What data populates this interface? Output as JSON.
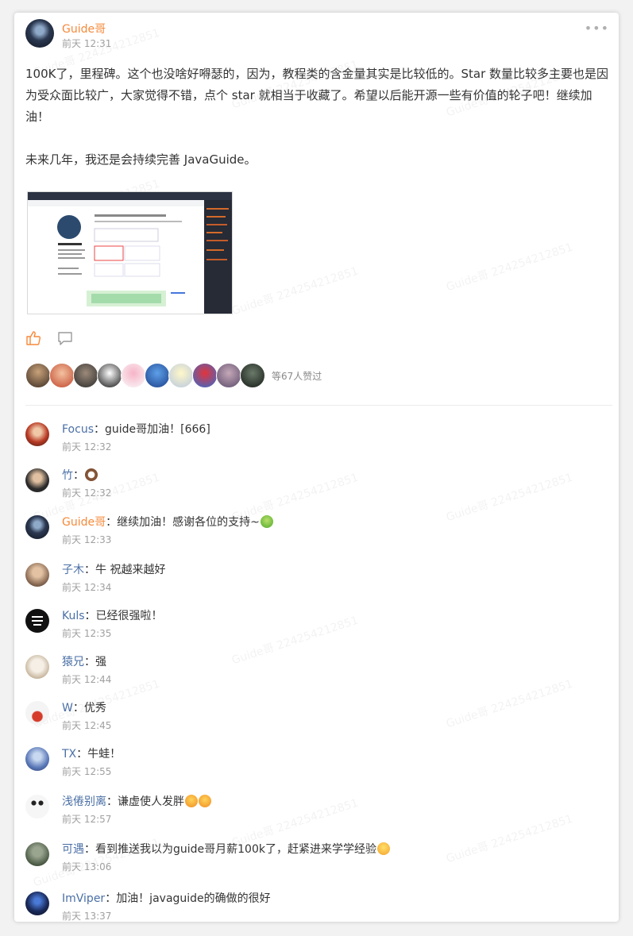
{
  "post": {
    "author": "Guide哥",
    "time": "前天 12:31",
    "paragraph1": "100K了，里程碑。这个也没啥好嘚瑟的，因为，教程类的含金量其实是比较低的。Star 数量比较多主要也是因为受众面比较广，大家觉得不错，点个 star 就相当于收藏了。希望以后能开源一些有价值的轮子吧！继续加油！",
    "paragraph2": "未来几年，我还是会持续完善 JavaGuide。",
    "more_icon": "more-dots-icon",
    "like_icon": "thumbs-up-icon",
    "comment_icon": "comment-bubble-icon",
    "likes_text": "等67人赞过"
  },
  "comments": [
    {
      "name": "Focus",
      "sep": "：",
      "text": "guide哥加油！[666]",
      "time": "前天 12:32"
    },
    {
      "name": "竹",
      "sep": "：",
      "text": "",
      "emoji": "cow-emoji",
      "time": "前天 12:32"
    },
    {
      "name": "Guide哥",
      "sep": "：",
      "text": "继续加油！感谢各位的支持~",
      "emoji": "green-emoji",
      "time": "前天 12:33"
    },
    {
      "name": "子木",
      "sep": "：",
      "text": "牛 祝越来越好",
      "time": "前天 12:34"
    },
    {
      "name": "Kuls",
      "sep": "：",
      "text": "已经很强啦！",
      "time": "前天 12:35"
    },
    {
      "name": "猿兄",
      "sep": "：",
      "text": "强",
      "time": "前天 12:44"
    },
    {
      "name": "W",
      "sep": "：",
      "text": "优秀",
      "time": "前天 12:45"
    },
    {
      "name": "TX",
      "sep": "：",
      "text": "牛蛙！",
      "time": "前天 12:55"
    },
    {
      "name": "浅倦别离",
      "sep": "：",
      "text": "谦虚使人发胖",
      "emoji": "grin-emoji",
      "time": "前天 12:57"
    },
    {
      "name": "可遇",
      "sep": "：",
      "text": "看到推送我以为guide哥月薪100k了，赶紧进来学学经验",
      "emoji": "laugh-emoji",
      "time": "前天 13:06"
    },
    {
      "name": "ImViper",
      "sep": "：",
      "text": "加油！javaguide的确做的很好",
      "time": "前天 13:37"
    }
  ],
  "watermark": "Guide哥 224254212851",
  "colors": {
    "author": "#f6893a",
    "name": "#4a6fa5",
    "time": "#a0a0a0"
  }
}
